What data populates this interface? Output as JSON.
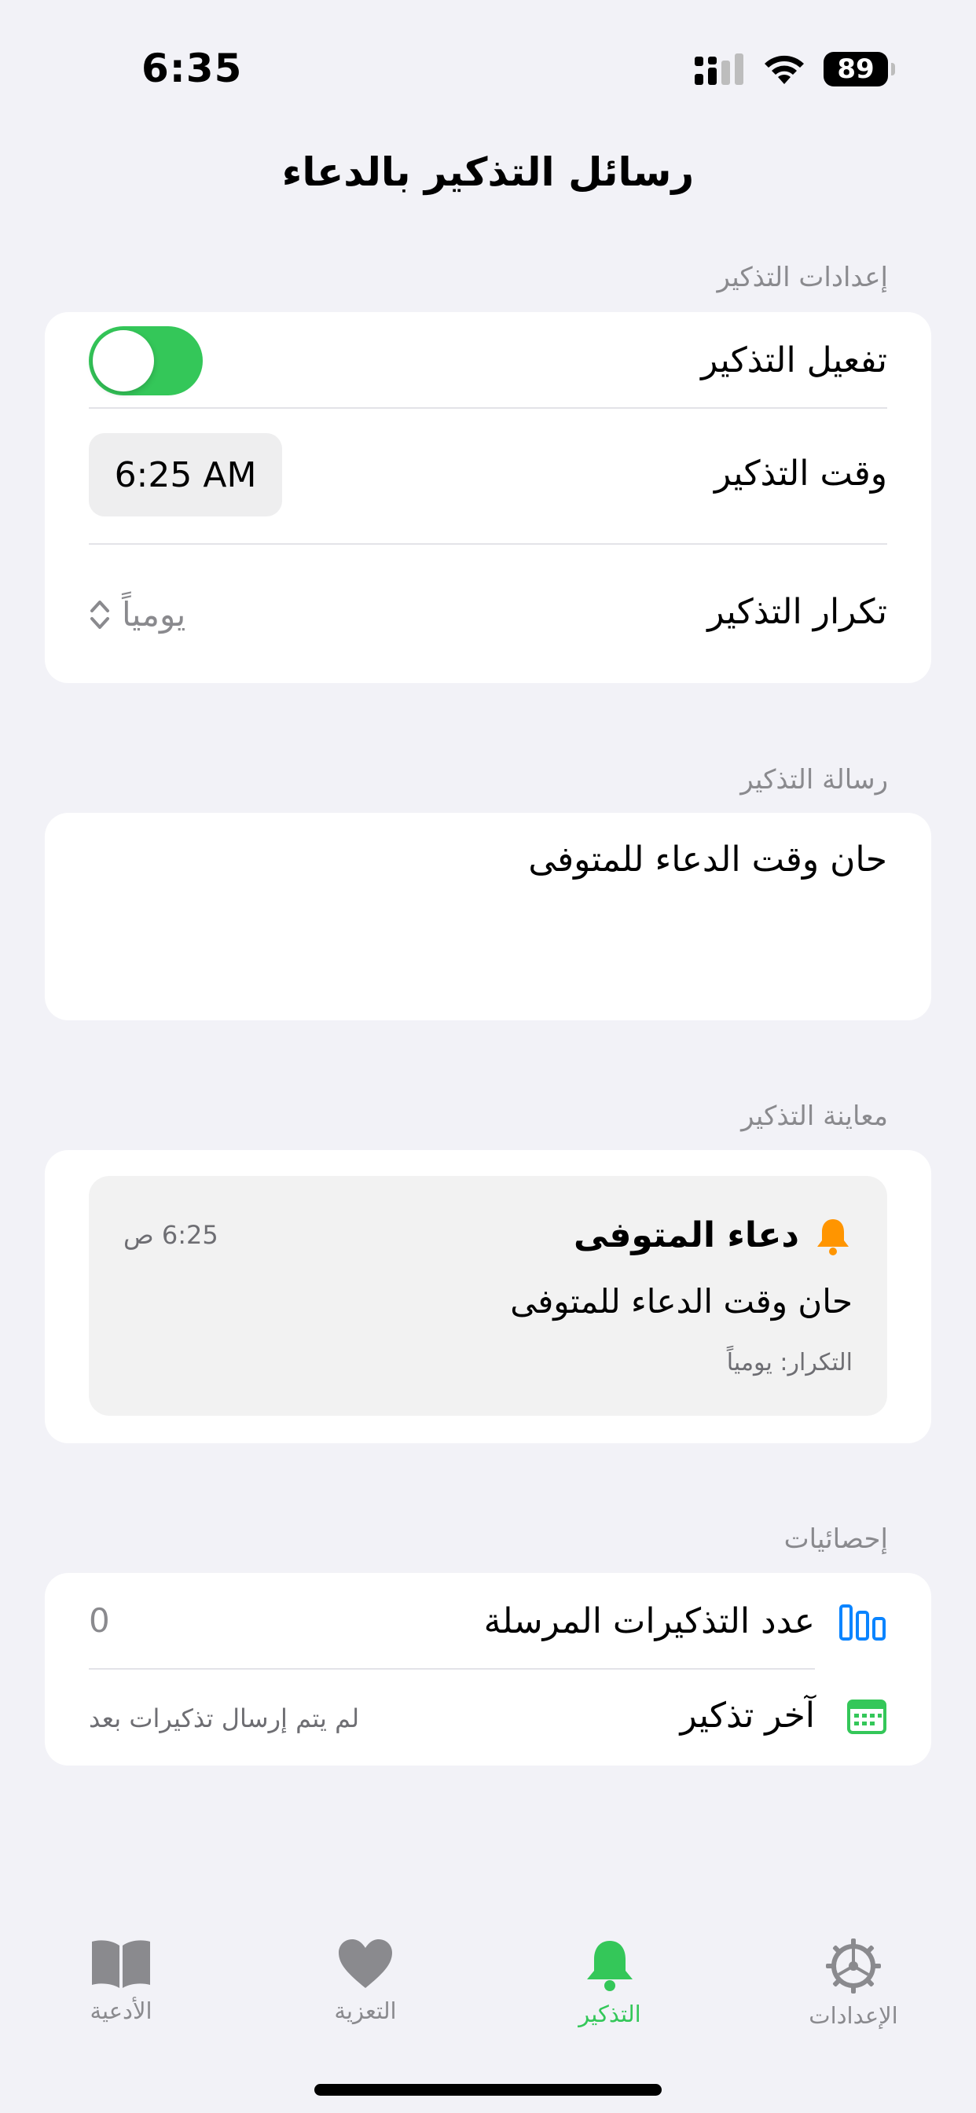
{
  "status_bar": {
    "time": "6:35",
    "battery": "89"
  },
  "nav": {
    "title": "رسائل التذكير بالدعاء"
  },
  "settings_section": {
    "label": "إعدادات التذكير",
    "enable_label": "تفعيل التذكير",
    "enabled": true,
    "time_label": "وقت التذكير",
    "time_value": "6:25 AM",
    "repeat_label": "تكرار التذكير",
    "repeat_value": "يومياً"
  },
  "message_section": {
    "label": "رسالة التذكير",
    "message": "حان وقت الدعاء للمتوفى"
  },
  "preview_section": {
    "label": "معاينة التذكير",
    "title": "دعاء المتوفى",
    "time": "6:25 ص",
    "message": "حان وقت الدعاء للمتوفى",
    "repeat": "التكرار: يومياً"
  },
  "stats_section": {
    "label": "إحصائيات",
    "sent_label": "عدد التذكيرات المرسلة",
    "sent_value": "0",
    "last_label": "آخر تذكير",
    "last_value": "لم يتم إرسال تذكيرات بعد"
  },
  "tab_bar": {
    "tabs": [
      {
        "label": "الأدعية",
        "icon": "book-icon"
      },
      {
        "label": "التعزية",
        "icon": "heart-icon"
      },
      {
        "label": "التذكير",
        "icon": "bell-icon"
      },
      {
        "label": "الإعدادات",
        "icon": "gear-icon"
      }
    ],
    "active_index": 2
  },
  "colors": {
    "accent": "#34C759",
    "bell": "#FF9500",
    "chart": "#0A84FF",
    "inactive": "#8A8A8E"
  }
}
